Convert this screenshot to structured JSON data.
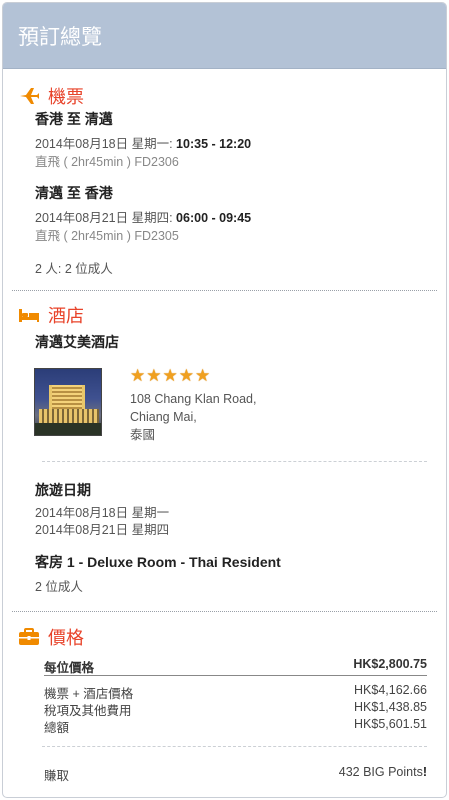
{
  "header": {
    "title": "預訂總覽"
  },
  "flights": {
    "section_title": "機票",
    "outbound": {
      "route": "香港 至 清邁",
      "date": "2014年08月18日 星期一:",
      "time": "10:35 - 12:20",
      "details": "直飛 ( 2hr45min ) FD2306"
    },
    "return": {
      "route": "清邁 至 香港",
      "date": "2014年08月21日 星期四:",
      "time": "06:00 - 09:45",
      "details": "直飛 ( 2hr45min ) FD2305"
    },
    "passengers": "2 人:  2 位成人"
  },
  "hotel": {
    "section_title": "酒店",
    "name": "清邁艾美酒店",
    "rating": 5,
    "address_line1": "108 Chang Klan Road,",
    "address_line2": "Chiang Mai,",
    "address_line3": "泰國",
    "travel_dates_title": "旅遊日期",
    "check_in": "2014年08月18日  星期一",
    "check_out": "2014年08月21日  星期四",
    "room_title": "客房 1 - Deluxe Room - Thai Resident",
    "room_guests": "2 位成人"
  },
  "price": {
    "section_title": "價格",
    "per_person_label": "每位價格",
    "per_person_value": "HK$2,800.75",
    "items": [
      {
        "label": "機票 + 酒店價格",
        "value": "HK$4,162.66"
      },
      {
        "label": "稅項及其他費用",
        "value": "HK$1,438.85"
      },
      {
        "label": "總額",
        "value": "HK$5,601.51"
      }
    ],
    "earn_label": "賺取",
    "earn_value": "432 BIG Points",
    "earn_suffix": "!"
  },
  "colors": {
    "header_bg": "#b3c2d6",
    "accent": "#e8432a",
    "icon": "#f08a00",
    "star": "#f0a020"
  },
  "icons": {
    "flights": "airplane-icon",
    "hotel": "bed-icon",
    "price": "briefcase-icon",
    "rating": "star-icon"
  }
}
